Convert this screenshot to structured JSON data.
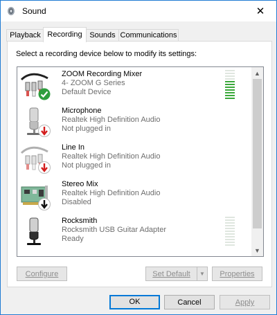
{
  "window": {
    "title": "Sound",
    "close_label": "✕"
  },
  "tabs": [
    {
      "label": "Playback"
    },
    {
      "label": "Recording"
    },
    {
      "label": "Sounds"
    },
    {
      "label": "Communications"
    }
  ],
  "instruction": "Select a recording device below to modify its settings:",
  "devices": [
    {
      "name": "ZOOM Recording Mixer",
      "description": "4- ZOOM G Series",
      "status": "Default Device",
      "badge": "green-check-icon",
      "meter_level": 0.6
    },
    {
      "name": "Microphone",
      "description": "Realtek High Definition Audio",
      "status": "Not plugged in",
      "badge": "red-down-arrow-icon"
    },
    {
      "name": "Line In",
      "description": "Realtek High Definition Audio",
      "status": "Not plugged in",
      "badge": "red-down-arrow-icon"
    },
    {
      "name": "Stereo Mix",
      "description": "Realtek High Definition Audio",
      "status": "Disabled",
      "badge": "black-down-arrow-icon"
    },
    {
      "name": "Rocksmith",
      "description": "Rocksmith USB Guitar Adapter",
      "status": "Ready",
      "badge": "",
      "meter_level": 0
    }
  ],
  "buttons": {
    "configure": "Configure",
    "set_default": "Set Default",
    "properties": "Properties",
    "ok": "OK",
    "cancel": "Cancel",
    "apply": "Apply"
  },
  "colors": {
    "accent": "#0078d7",
    "meter_on": "#3aa83a",
    "meter_off": "#dfe6df"
  }
}
